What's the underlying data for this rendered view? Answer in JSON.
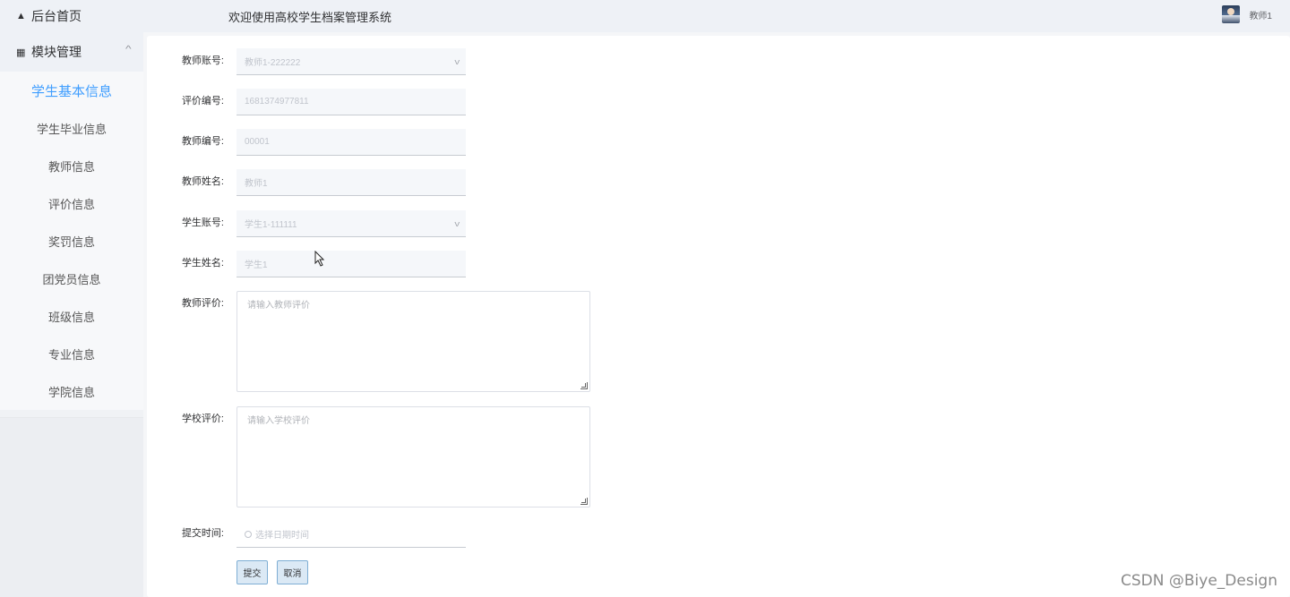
{
  "sidebar": {
    "home_label": "后台首页",
    "group_label": "模块管理",
    "items": [
      {
        "label": "学生基本信息",
        "active": true
      },
      {
        "label": "学生毕业信息"
      },
      {
        "label": "教师信息"
      },
      {
        "label": "评价信息"
      },
      {
        "label": "奖罚信息"
      },
      {
        "label": "团党员信息"
      },
      {
        "label": "班级信息"
      },
      {
        "label": "专业信息"
      },
      {
        "label": "学院信息"
      }
    ]
  },
  "header": {
    "title": "欢迎使用高校学生档案管理系统",
    "user_name": "教师1"
  },
  "form": {
    "teacher_account": {
      "label": "教师账号:",
      "value": "教师1-222222"
    },
    "eval_no": {
      "label": "评价编号:",
      "value": "1681374977811"
    },
    "teacher_no": {
      "label": "教师编号:",
      "value": "00001"
    },
    "teacher_name": {
      "label": "教师姓名:",
      "value": "教师1"
    },
    "student_account": {
      "label": "学生账号:",
      "value": "学生1-111111"
    },
    "student_name": {
      "label": "学生姓名:",
      "value": "学生1"
    },
    "teacher_eval": {
      "label": "教师评价:",
      "placeholder": "请输入教师评价"
    },
    "school_eval": {
      "label": "学校评价:",
      "placeholder": "请输入学校评价"
    },
    "submit_time": {
      "label": "提交时间:",
      "placeholder": "选择日期时间"
    },
    "submit_label": "提交",
    "cancel_label": "取消"
  },
  "watermark": "CSDN @Biye_Design",
  "colors": {
    "accent": "#409eff",
    "button_bg": "#dbe9f5",
    "button_border": "#7eaed4"
  }
}
